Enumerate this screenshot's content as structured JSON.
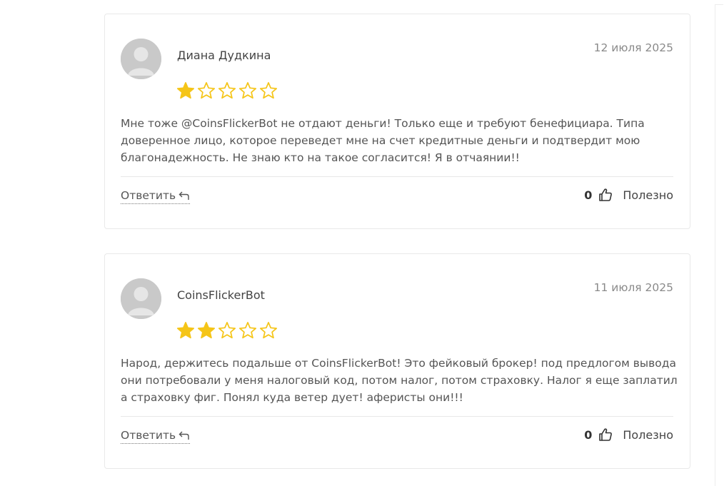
{
  "reviews": [
    {
      "author": "Диана Дудкина",
      "date": "12 июля 2025",
      "rating": 1,
      "max_rating": 5,
      "text": "Мне тоже @CoinsFlickerBot не отдают деньги! Только еще и требуют бенефициара. Типа доверенное лицо, которое переведет мне на счет кредитные деньги и подтвердит мою благонадежность. Не знаю кто на такое согласится! Я в отчаянии!!",
      "reply_label": "Ответить",
      "helpful_count": "0",
      "helpful_label": "Полезно"
    },
    {
      "author": "CoinsFlickerBot",
      "date": "11 июля 2025",
      "rating": 2,
      "max_rating": 5,
      "text": "Народ, держитесь подальше от CoinsFlickerBot! Это фейковый брокер! под предлогом вывода они потребовали у меня налоговый код, потом налог, потом страховку. Налог я еще заплатил а страховку фиг. Понял куда ветер дует! аферисты они!!!",
      "reply_label": "Ответить",
      "helpful_count": "0",
      "helpful_label": "Полезно"
    }
  ],
  "colors": {
    "star_fill": "#f5c518",
    "star_empty_outline": "#f5c518",
    "avatar_bg": "#c9c9c9",
    "card_border": "#e9e9e9"
  },
  "icons": {
    "avatar": "user-silhouette",
    "reply": "reply-arrow-icon",
    "helpful": "thumbs-up-icon",
    "rating": "star-icon"
  }
}
